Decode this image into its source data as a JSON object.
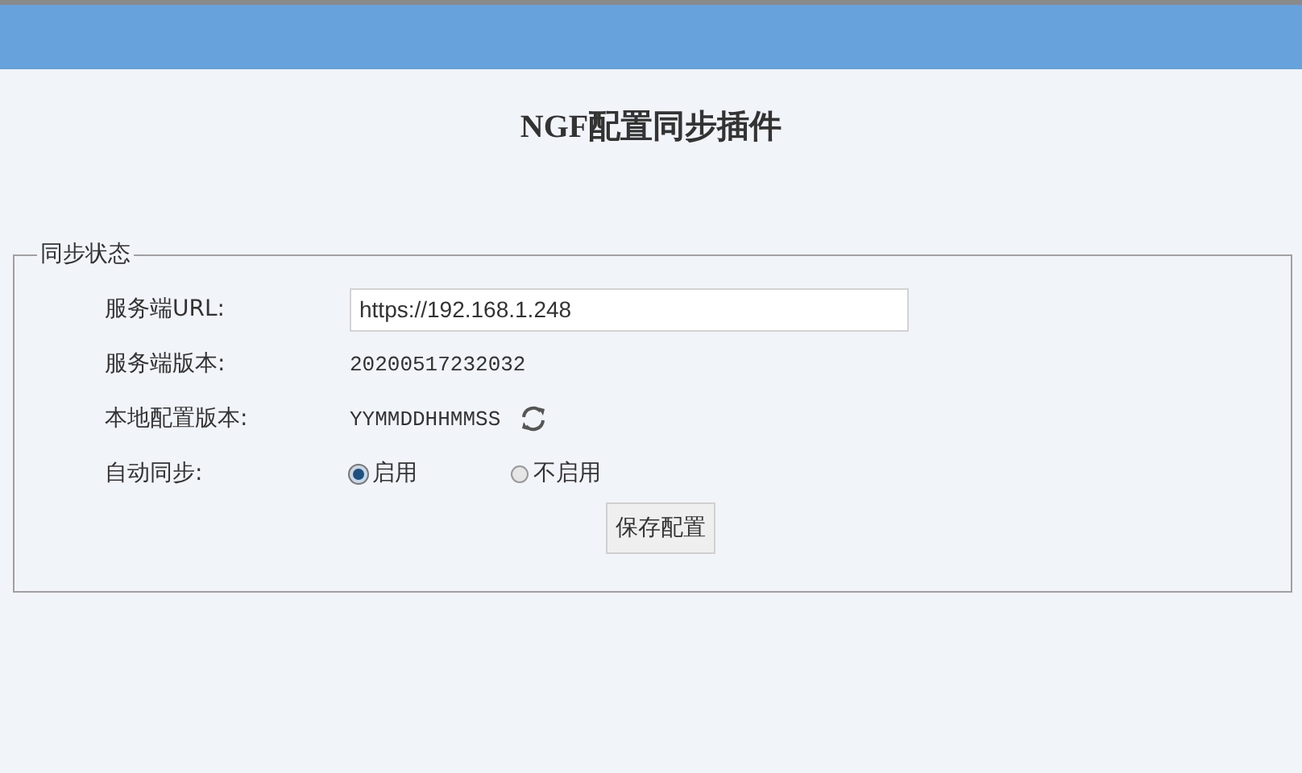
{
  "page": {
    "title": "NGF配置同步插件"
  },
  "panel": {
    "legend": "同步状态",
    "rows": [
      {
        "kind": "input",
        "label": "服务端URL:",
        "value": "https://192.168.1.248"
      },
      {
        "kind": "text",
        "label": "服务端版本:",
        "value": "20200517232032"
      },
      {
        "kind": "refresh",
        "label": "本地配置版本:",
        "value": "YYMMDDHHMMSS"
      },
      {
        "kind": "radio",
        "label": "自动同步:",
        "options": [
          {
            "label": "启用",
            "selected": true
          },
          {
            "label": "不启用",
            "selected": false
          }
        ]
      }
    ],
    "save_button": "保存配置"
  }
}
